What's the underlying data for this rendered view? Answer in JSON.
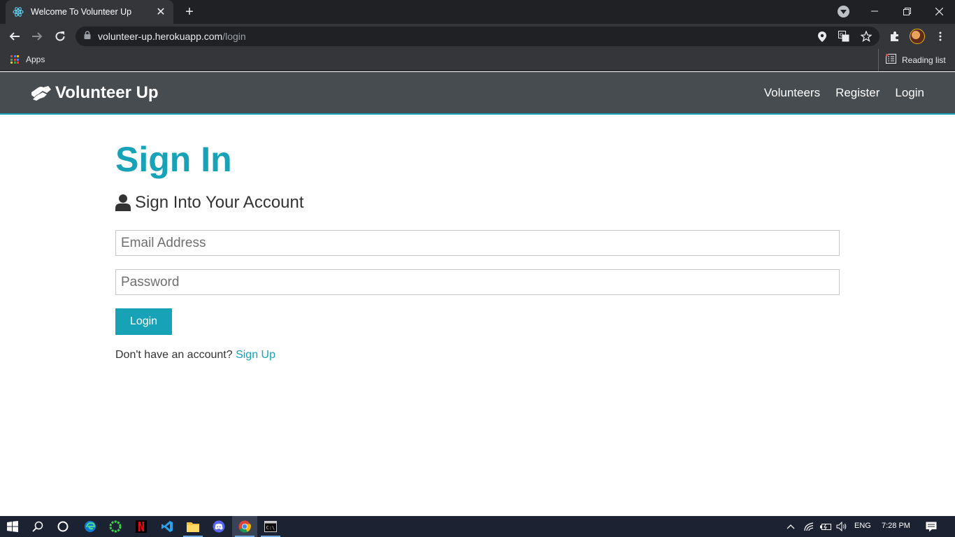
{
  "browser": {
    "tab_title": "Welcome To Volunteer Up",
    "url_host": "volunteer-up.herokuapp.com",
    "url_path": "/login",
    "bookmarks": {
      "apps_label": "Apps",
      "reading_list_label": "Reading list"
    }
  },
  "site": {
    "brand": "Volunteer Up",
    "nav": [
      {
        "label": "Volunteers"
      },
      {
        "label": "Register"
      },
      {
        "label": "Login"
      }
    ],
    "accent_color": "#17a2b8",
    "navbar_color": "#474c50"
  },
  "login_form": {
    "title": "Sign In",
    "subtitle": "Sign Into Your Account",
    "email": {
      "placeholder": "Email Address",
      "value": ""
    },
    "password": {
      "placeholder": "Password",
      "value": ""
    },
    "submit_label": "Login",
    "signup_prompt": "Don't have an account?",
    "signup_link": "Sign Up"
  },
  "taskbar": {
    "apps": [
      "windows-start",
      "search",
      "cortana",
      "edge",
      "media-player",
      "netflix",
      "vscode",
      "file-explorer",
      "discord",
      "chrome",
      "terminal"
    ],
    "language": "ENG",
    "time": "7:28 PM"
  }
}
